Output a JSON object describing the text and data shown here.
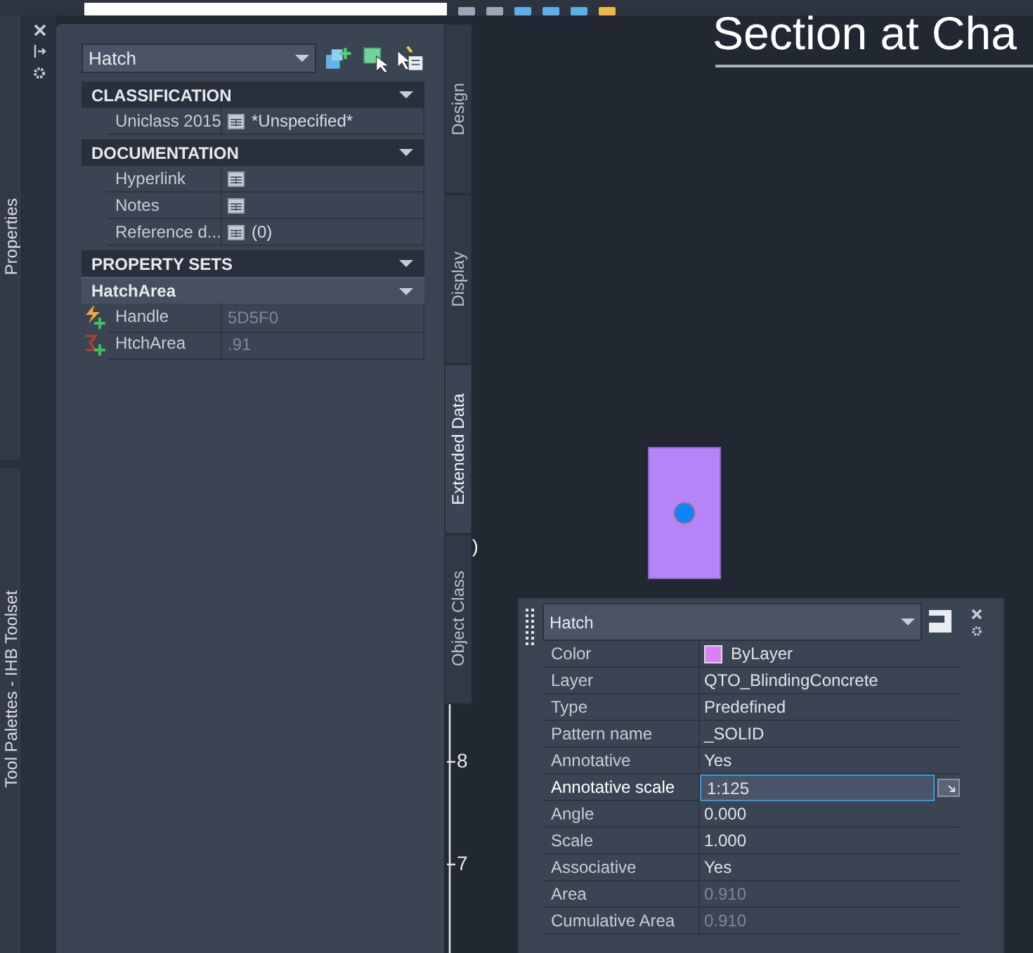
{
  "side_palettes": [
    {
      "title": "Properties",
      "kind": "top"
    },
    {
      "title": "Tool Palettes - IHB Toolset",
      "kind": "bottom"
    }
  ],
  "panel": {
    "object_type": "Hatch",
    "sections": [
      {
        "title": "CLASSIFICATION",
        "expanded": true,
        "rows": [
          {
            "label": "Uniclass 2015",
            "value": "*Unspecified*",
            "editor": true
          }
        ]
      },
      {
        "title": "DOCUMENTATION",
        "expanded": true,
        "rows": [
          {
            "label": "Hyperlink",
            "editor": true
          },
          {
            "label": "Notes",
            "editor": true
          },
          {
            "label": "Reference d...",
            "value": "(0)",
            "editor": true
          }
        ]
      },
      {
        "title": "PROPERTY SETS",
        "expanded": true,
        "subgroup": "HatchArea",
        "rows": [
          {
            "label": "Handle",
            "value": "5D5F0",
            "kind": "handle",
            "disabled": true
          },
          {
            "label": "HtchArea",
            "value": ".91",
            "kind": "formula",
            "disabled": true
          }
        ]
      }
    ]
  },
  "tabs": [
    {
      "label": "Design",
      "selected": false
    },
    {
      "label": "Display",
      "selected": false
    },
    {
      "label": "Extended Data",
      "selected": true
    },
    {
      "label": "Object Class",
      "selected": false
    }
  ],
  "canvas": {
    "title": "Section at Cha",
    "stray_mark": ")",
    "ruler_labels": [
      "8",
      "7"
    ]
  },
  "quick_properties": {
    "object_type": "Hatch",
    "rows": [
      {
        "label": "Color",
        "value": "ByLayer",
        "color": "#dd80f7",
        "disabled": false,
        "active": false
      },
      {
        "label": "Layer",
        "value": "QTO_BlindingConcrete",
        "disabled": false,
        "active": false
      },
      {
        "label": "Type",
        "value": "Predefined",
        "disabled": false,
        "active": false
      },
      {
        "label": "Pattern name",
        "value": "_SOLID",
        "disabled": false,
        "active": false
      },
      {
        "label": "Annotative",
        "value": "Yes",
        "disabled": false,
        "active": false
      },
      {
        "label": "Annotative scale",
        "value": "1:125",
        "disabled": false,
        "active": true
      },
      {
        "label": "Angle",
        "value": "0.000",
        "disabled": false,
        "active": false
      },
      {
        "label": "Scale",
        "value": "1.000",
        "disabled": false,
        "active": false
      },
      {
        "label": "Associative",
        "value": "Yes",
        "disabled": false,
        "active": false
      },
      {
        "label": "Area",
        "value": "0.910",
        "disabled": true,
        "active": false
      },
      {
        "label": "Cumulative Area",
        "value": "0.910",
        "disabled": true,
        "active": false
      }
    ]
  }
}
